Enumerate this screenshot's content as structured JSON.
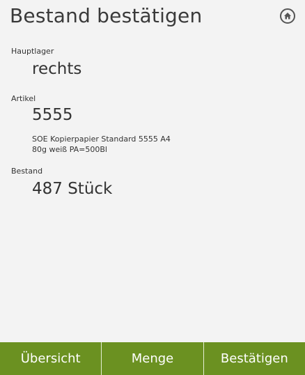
{
  "header": {
    "title": "Bestand bestätigen",
    "home_icon": "home-icon"
  },
  "fields": {
    "lager_label": "Hauptlager",
    "lager_value": "rechts",
    "artikel_label": "Artikel",
    "artikel_value": "5555",
    "artikel_desc_line1": "SOE Kopierpapier Standard 5555 A4",
    "artikel_desc_line2": "80g weiß PA=500Bl",
    "bestand_label": "Bestand",
    "bestand_value": "487 Stück"
  },
  "bottom_bar": {
    "color": "#6b9121",
    "overview_label": "Übersicht",
    "quantity_label": "Menge",
    "confirm_label": "Bestätigen"
  }
}
